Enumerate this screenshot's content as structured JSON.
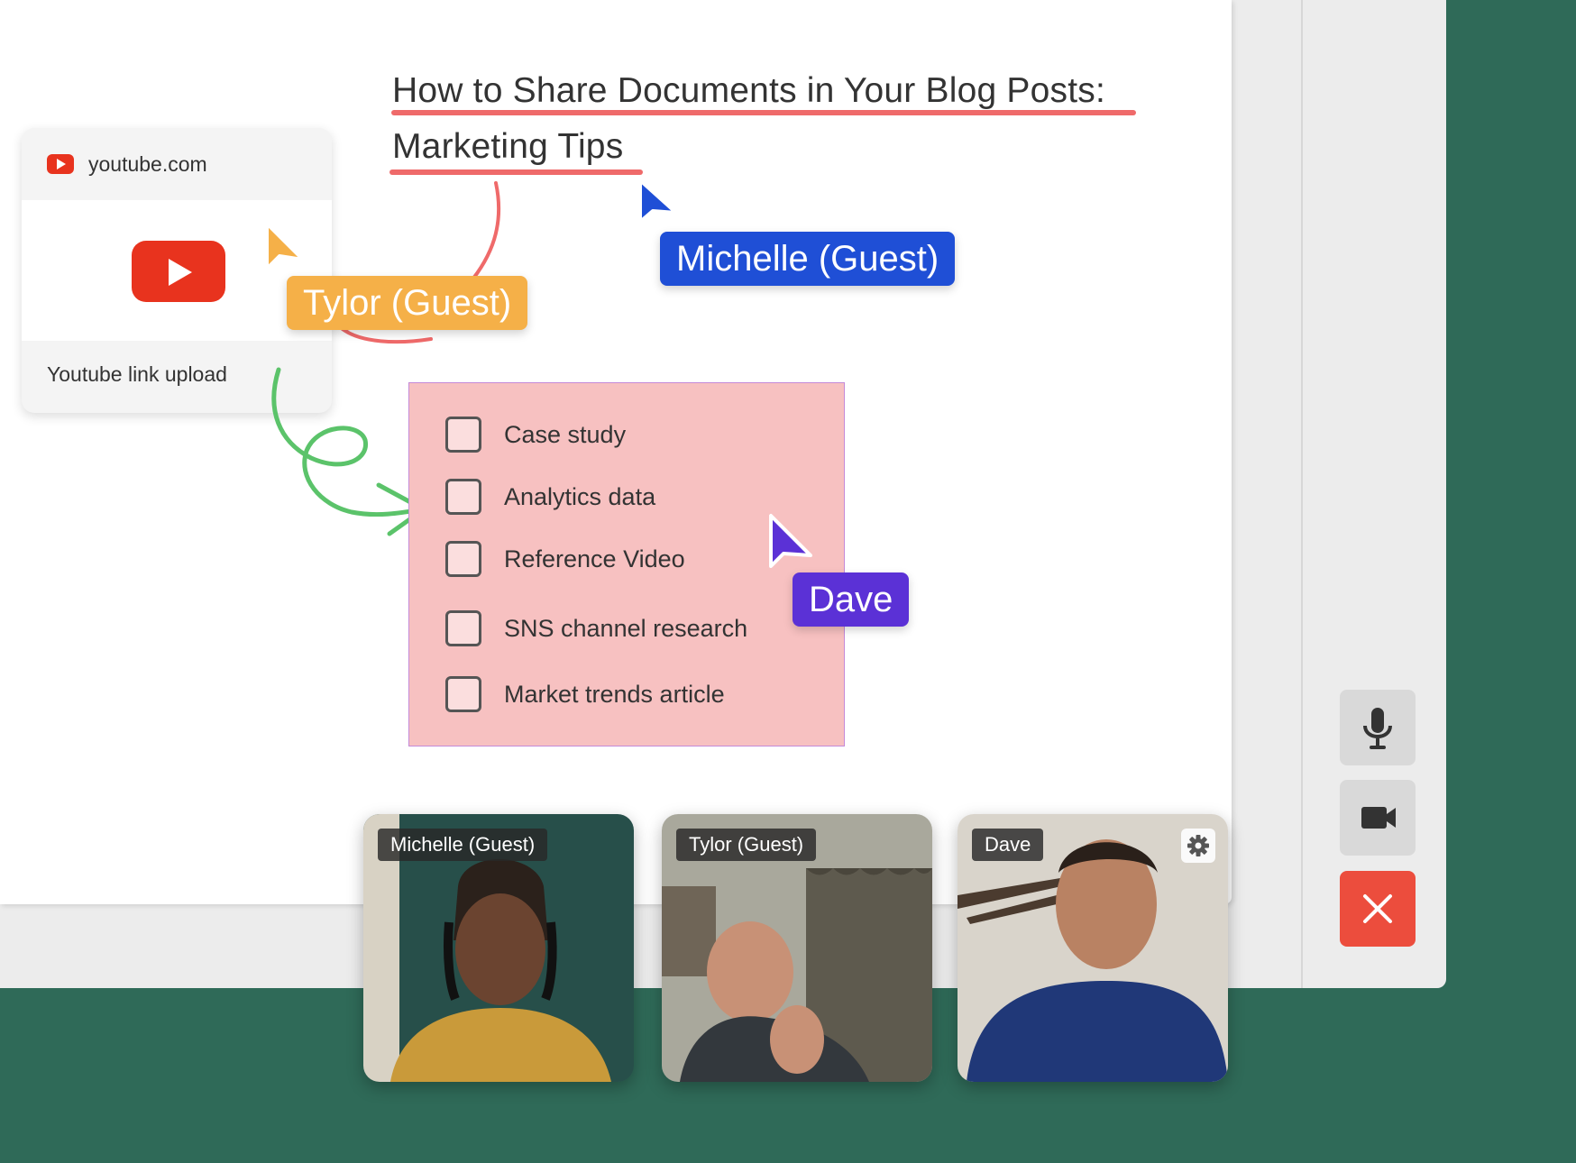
{
  "document": {
    "title_line1": "How to Share Documents in Your Blog Posts:",
    "title_line2": "Marketing Tips"
  },
  "link_card": {
    "domain": "youtube.com",
    "caption": "Youtube link upload"
  },
  "checklist": {
    "items": [
      {
        "label": "Case study",
        "checked": false
      },
      {
        "label": "Analytics data",
        "checked": false
      },
      {
        "label": "Reference Video",
        "checked": false
      },
      {
        "label": "SNS channel research",
        "checked": false
      },
      {
        "label": "Market trends article",
        "checked": false
      }
    ]
  },
  "cursors": [
    {
      "name": "Michelle (Guest)",
      "color": "#1f4fd6"
    },
    {
      "name": "Tylor (Guest)",
      "color": "#f5b048"
    },
    {
      "name": "Dave",
      "color": "#5b31d6"
    }
  ],
  "participants": [
    {
      "name": "Michelle (Guest)"
    },
    {
      "name": "Tylor (Guest)"
    },
    {
      "name": "Dave"
    }
  ],
  "controls": {
    "microphone": "microphone-icon",
    "camera": "video-camera-icon",
    "end_call": "close-icon"
  },
  "colors": {
    "background": "#2f6a58",
    "annotation_red": "#ef6a6a",
    "arrow_green": "#5bc36a",
    "end_call_red": "#ec4d3d",
    "youtube_red": "#e8331e"
  }
}
